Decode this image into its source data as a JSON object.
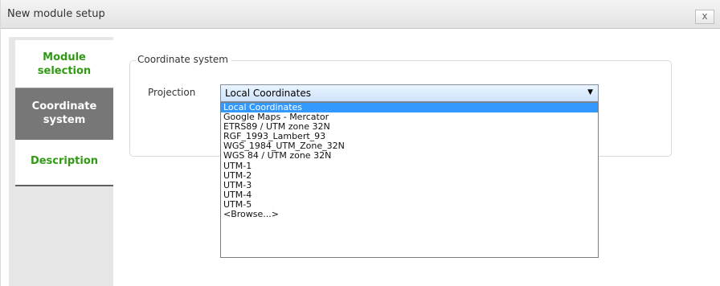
{
  "window": {
    "title": "New module setup",
    "close_label": "x"
  },
  "sidebar": {
    "items": [
      {
        "label": "Module\nselection",
        "state": "normal"
      },
      {
        "label": "Coordinate\nsystem",
        "state": "active"
      },
      {
        "label": "Description",
        "state": "normal"
      }
    ]
  },
  "coordinate_system": {
    "group_title": "Coordinate system",
    "projection_label": "Projection",
    "selected_value": "Local Coordinates",
    "options": [
      "Local Coordinates",
      "Google Maps - Mercator",
      "ETRS89 / UTM zone 32N",
      "RGF_1993_Lambert_93",
      "WGS_1984_UTM_Zone_32N",
      "WGS 84 / UTM zone 32N",
      "UTM-1",
      "UTM-2",
      "UTM-3",
      "UTM-4",
      "UTM-5",
      "<Browse...>"
    ]
  },
  "colors": {
    "accent_green": "#2f9a12",
    "active_tab": "#777777",
    "selection_blue": "#3399ff"
  }
}
